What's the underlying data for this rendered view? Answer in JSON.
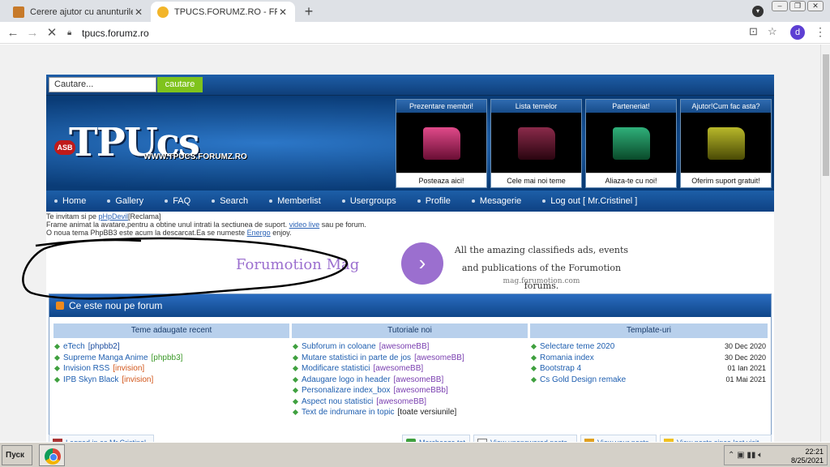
{
  "browser": {
    "tabs": [
      {
        "title": "Cerere ajutor cu anunturile de tip ale",
        "active": false
      },
      {
        "title": "TPUCS.FORUMZ.RO - FREE GAME C",
        "active": true
      }
    ],
    "url": "tpucs.forumz.ro",
    "profile_letter": "d"
  },
  "site": {
    "search_placeholder": "Cautare...",
    "search_button": "cautare",
    "logo_text": "TPUcs",
    "logo_url": "WWW.TPUCS.FORUMZ.RO",
    "logo_badge": "ASB",
    "feature_boxes": [
      {
        "title": "Prezentare membri!",
        "caption": "Posteaza aici!",
        "color": "#c0306a"
      },
      {
        "title": "Lista temelor",
        "caption": "Cele mai noi teme",
        "color": "#5a1028"
      },
      {
        "title": "Parteneriat!",
        "caption": "Aliaza-te cu noi!",
        "color": "#1c8a5a"
      },
      {
        "title": "Ajutor!Cum fac asta?",
        "caption": "Oferim suport gratuit!",
        "color": "#8a8a10"
      }
    ],
    "nav": [
      "Home",
      "Gallery",
      "FAQ",
      "Search",
      "Memberlist",
      "Usergroups",
      "Profile",
      "Mesagerie",
      "Log out [ Mr.Cristinel ]"
    ],
    "notice": {
      "line1_prefix": "Te invitam si pe ",
      "line1_link": "pHpDevil",
      "line1_suffix": "[Reclama]",
      "line2_prefix": "Frame animat la avatare,pentru a obtine unul intrati la sectiunea de suport.",
      "line2_link": "video live",
      "line2_suffix": "sau pe forum.",
      "line3_prefix": "O noua tema PhpBB3 este acum la descarcat.Ea se numeste ",
      "line3_link": "Energo",
      "line3_suffix": "enjoy."
    },
    "ad": {
      "brand": "Forumotion Mag",
      "arrow": "›",
      "text": "All the amazing classifieds ads, events and publications of the Forumotion forums.",
      "url": "mag.forumotion.com"
    },
    "panel": {
      "title": "Ce este nou pe forum",
      "columns": [
        {
          "heading": "Teme adaugate recent",
          "items": [
            {
              "name": "eTech",
              "tag": "[phpbb2]",
              "tag_color": "#1f4fa0"
            },
            {
              "name": "Supreme Manga Anime",
              "tag": "[phpbb3]",
              "tag_color": "#3d9a2a"
            },
            {
              "name": "Invision RSS",
              "tag": "[invision]",
              "tag_color": "#d2561a"
            },
            {
              "name": "IPB Skyn Black",
              "tag": "[invision]",
              "tag_color": "#d2561a"
            }
          ]
        },
        {
          "heading": "Tutoriale noi",
          "items": [
            {
              "name": "Subforum in coloane",
              "tag": "[awesomeBB]",
              "tag_color": "#7a3fb0"
            },
            {
              "name": "Mutare statistici in parte de jos",
              "tag": "[awesomeBB]",
              "tag_color": "#7a3fb0"
            },
            {
              "name": "Modificare statistici",
              "tag": "[awesomeBB]",
              "tag_color": "#7a3fb0"
            },
            {
              "name": "Adaugare logo in header",
              "tag": "[awesomeBB]",
              "tag_color": "#7a3fb0"
            },
            {
              "name": "Personalizare index_box",
              "tag": "[awesomeBBb]",
              "tag_color": "#7a3fb0"
            },
            {
              "name": "Aspect nou statistici",
              "tag": "[awesomeBB]",
              "tag_color": "#7a3fb0"
            },
            {
              "name": "Text de indrumare in topic",
              "tag": "[toate versiunile]",
              "tag_color": "#222222"
            }
          ]
        },
        {
          "heading": "Template-uri",
          "items": [
            {
              "name": "Selectare teme 2020",
              "date": "30 Dec 2020"
            },
            {
              "name": "Romania index",
              "date": "30 Dec 2020"
            },
            {
              "name": "Bootstrap 4",
              "date": "01 Ian 2021"
            },
            {
              "name": "Cs Gold Design remake",
              "date": "01 Mai 2021"
            }
          ]
        }
      ]
    },
    "bottom": {
      "logged_in": "Logged in as Mr.Cristinel",
      "mark_read": "Marcheaza tot",
      "unanswered": "View unanswered posts",
      "your_posts": "View your posts",
      "since_last": "View posts since last visit"
    }
  },
  "taskbar": {
    "start_label": "Пуск",
    "time": "22:21",
    "date": "8/25/2021"
  }
}
